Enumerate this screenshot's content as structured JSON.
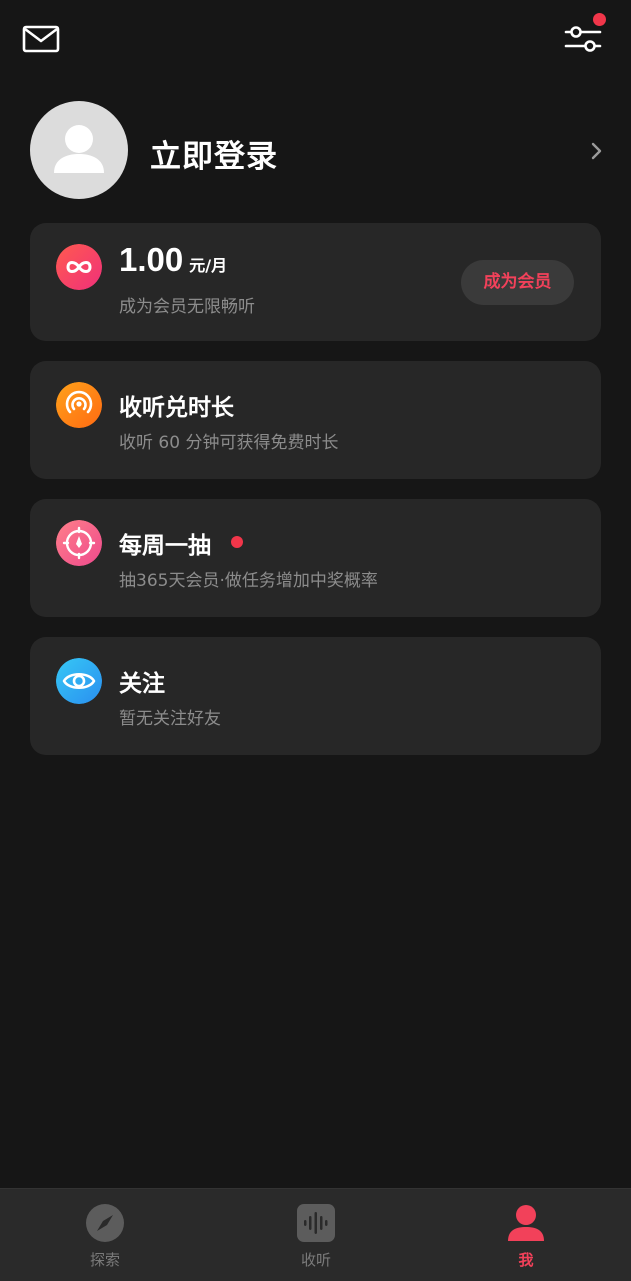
{
  "topbar": {
    "mail_icon": "mail-icon",
    "settings_icon": "settings-sliders-icon",
    "has_notification": true
  },
  "profile": {
    "login_text": "立即登录"
  },
  "cards": {
    "vip": {
      "price": "1.00",
      "unit": "元/月",
      "subtitle": "成为会员无限畅听",
      "button_label": "成为会员",
      "icon": "infinity-icon"
    },
    "listen": {
      "title": "收听兑时长",
      "subtitle": "收听 60 分钟可获得免费时长",
      "icon": "broadcast-icon"
    },
    "lottery": {
      "title": "每周一抽",
      "subtitle": "抽365天会员·做任务增加中奖概率",
      "icon": "lottery-wheel-icon"
    },
    "follow": {
      "title": "关注",
      "subtitle": "暂无关注好友",
      "icon": "eye-icon"
    }
  },
  "nav": {
    "items": [
      {
        "label": "探索",
        "icon": "compass-icon",
        "active": false
      },
      {
        "label": "收听",
        "icon": "soundwave-icon",
        "active": false
      },
      {
        "label": "我",
        "icon": "person-icon",
        "active": true
      }
    ]
  },
  "colors": {
    "background": "#161616",
    "card": "#272727",
    "accent": "#f2415a"
  }
}
